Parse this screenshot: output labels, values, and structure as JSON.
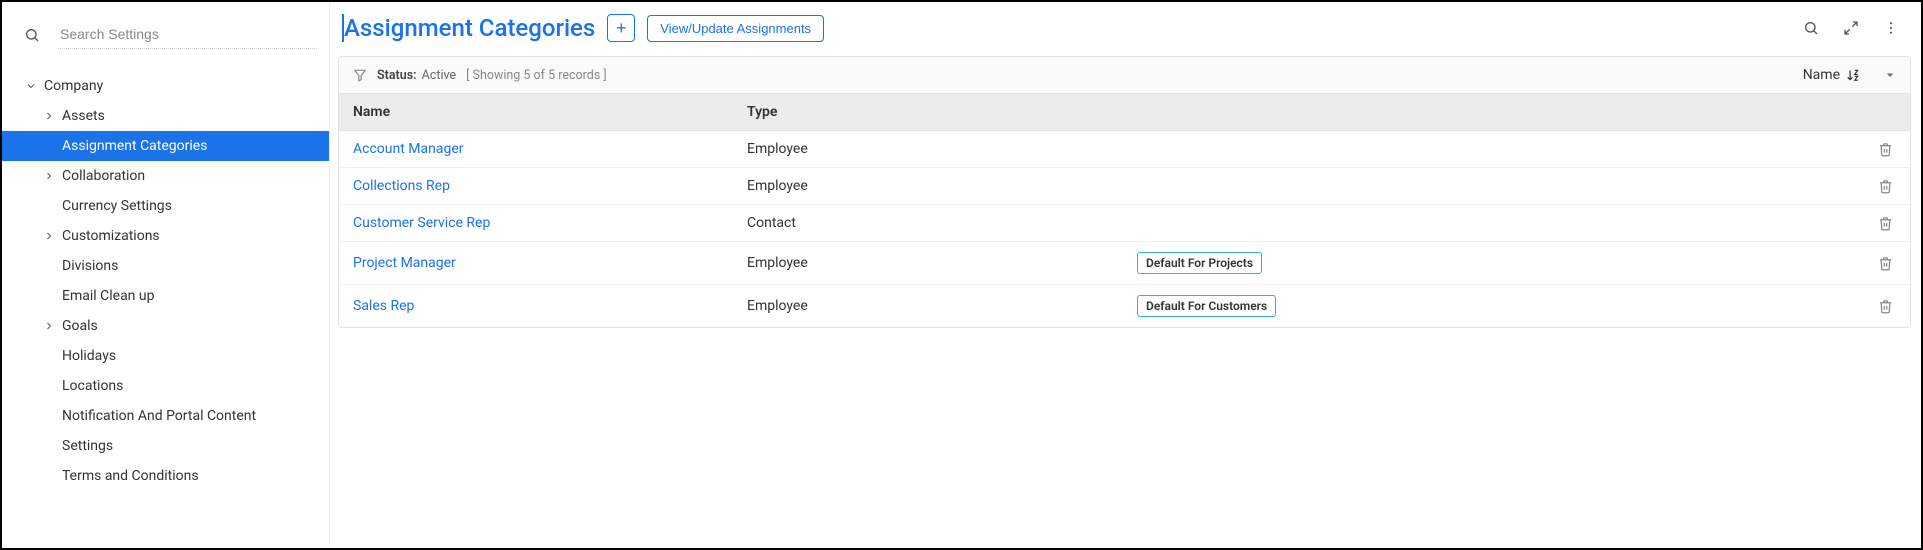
{
  "sidebar": {
    "search_placeholder": "Search Settings",
    "root_label": "Company",
    "items": [
      {
        "label": "Assets",
        "expandable": true,
        "selected": false
      },
      {
        "label": "Assignment Categories",
        "expandable": false,
        "selected": true
      },
      {
        "label": "Collaboration",
        "expandable": true,
        "selected": false
      },
      {
        "label": "Currency Settings",
        "expandable": false,
        "selected": false
      },
      {
        "label": "Customizations",
        "expandable": true,
        "selected": false
      },
      {
        "label": "Divisions",
        "expandable": false,
        "selected": false
      },
      {
        "label": "Email Clean up",
        "expandable": false,
        "selected": false
      },
      {
        "label": "Goals",
        "expandable": true,
        "selected": false
      },
      {
        "label": "Holidays",
        "expandable": false,
        "selected": false
      },
      {
        "label": "Locations",
        "expandable": false,
        "selected": false
      },
      {
        "label": "Notification And Portal Content",
        "expandable": false,
        "selected": false
      },
      {
        "label": "Settings",
        "expandable": false,
        "selected": false
      },
      {
        "label": "Terms and Conditions",
        "expandable": false,
        "selected": false
      }
    ]
  },
  "header": {
    "title": "Assignment Categories",
    "add_icon": "+",
    "view_update_label": "View/Update Assignments"
  },
  "filter": {
    "status_label": "Status:",
    "status_value": "Active",
    "records_info": "[ Showing 5 of 5 records ]",
    "sort_label": "Name"
  },
  "table": {
    "columns": {
      "name": "Name",
      "type": "Type"
    },
    "rows": [
      {
        "name": "Account Manager",
        "type": "Employee",
        "badge": ""
      },
      {
        "name": "Collections Rep",
        "type": "Employee",
        "badge": ""
      },
      {
        "name": "Customer Service Rep",
        "type": "Contact",
        "badge": ""
      },
      {
        "name": "Project Manager",
        "type": "Employee",
        "badge": "Default For Projects"
      },
      {
        "name": "Sales Rep",
        "type": "Employee",
        "badge": "Default For Customers"
      }
    ]
  }
}
